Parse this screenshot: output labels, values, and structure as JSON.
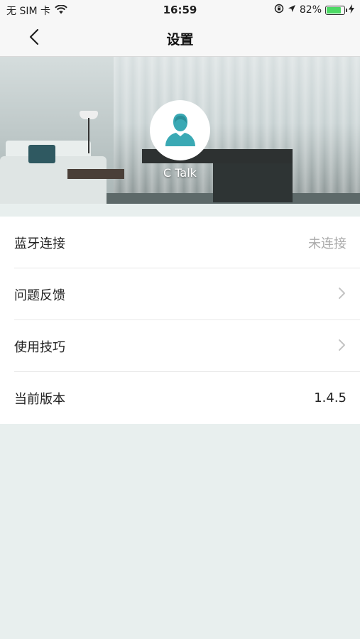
{
  "status_bar": {
    "carrier": "无 SIM 卡",
    "time": "16:59",
    "battery": "82%",
    "battery_level": 0.82,
    "icons": [
      "wifi-icon",
      "rotation-lock-icon",
      "location-icon",
      "battery-icon",
      "charging-icon"
    ]
  },
  "nav": {
    "title": "设置",
    "back_icon": "chevron-left-icon"
  },
  "profile": {
    "name": "C Talk",
    "avatar_icon": "user-silhouette-icon",
    "avatar_color": "#3aa9b4"
  },
  "settings": [
    {
      "label": "蓝牙连接",
      "value": "未连接",
      "has_chevron": false
    },
    {
      "label": "问题反馈",
      "value": "",
      "has_chevron": true
    },
    {
      "label": "使用技巧",
      "value": "",
      "has_chevron": true
    },
    {
      "label": "当前版本",
      "value": "1.4.5",
      "has_chevron": false
    }
  ],
  "colors": {
    "background": "#e8efee",
    "bar": "#f7f7f7",
    "battery_green": "#4cd964"
  }
}
